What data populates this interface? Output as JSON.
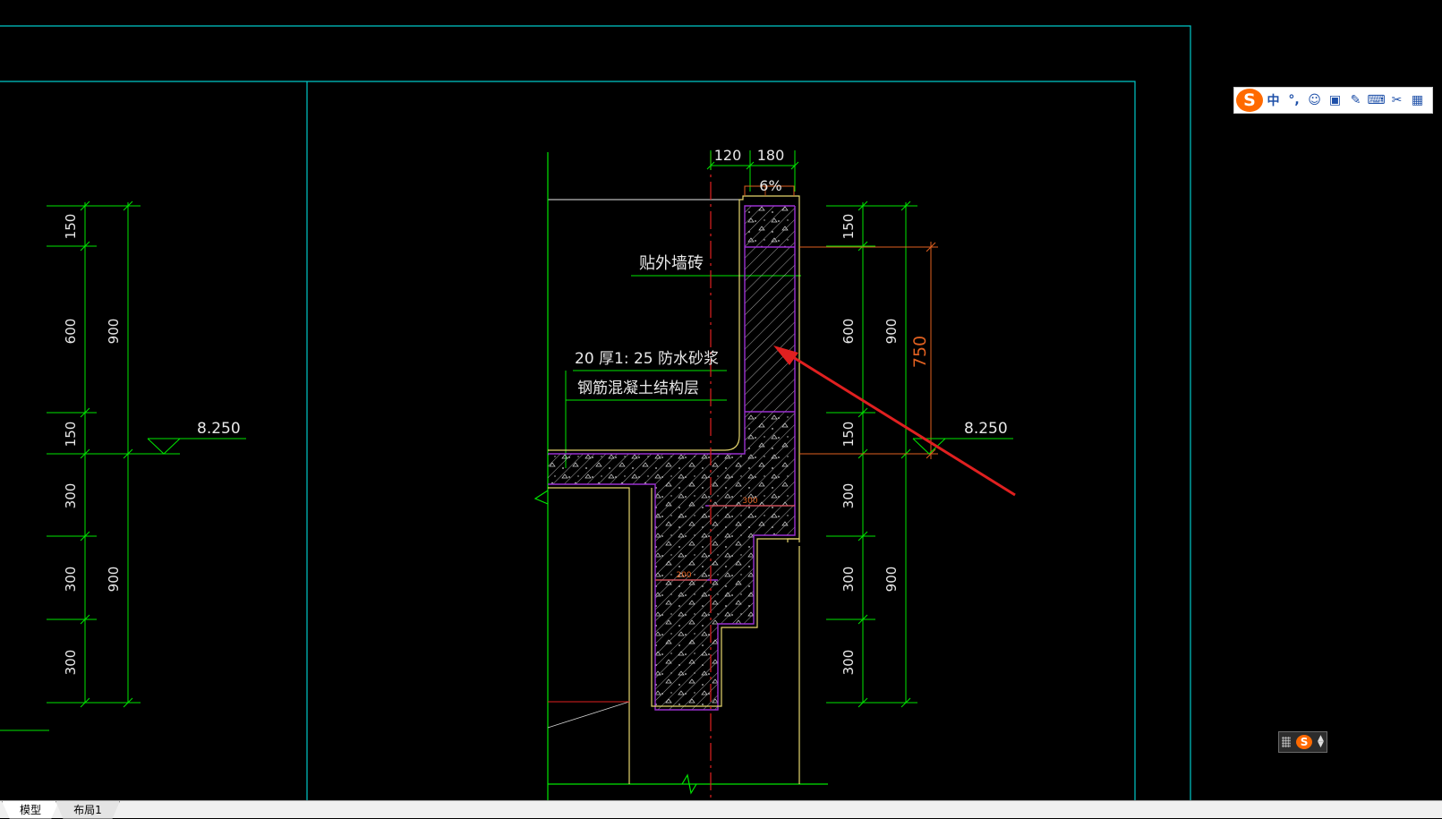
{
  "dims": {
    "top_w1": "120",
    "top_w2": "180",
    "slope": "6%",
    "left_seg": [
      "150",
      "600",
      "150",
      "300",
      "300",
      "300"
    ],
    "left_tot": [
      "900",
      "900"
    ],
    "right_seg": [
      "150",
      "600",
      "150",
      "300",
      "300",
      "300"
    ],
    "right_tot": [
      "900",
      "900"
    ],
    "red_dim": "750",
    "elev_left": "8.250",
    "elev_right": "8.250",
    "inner_300": "300",
    "inner_200": "200"
  },
  "labels": {
    "tile": "贴外墙砖",
    "mortar": "20 厚1: 25 防水砂浆",
    "concrete": "钢筋混凝土结构层"
  },
  "ime": {
    "logo": "S",
    "buttons": [
      "中",
      "°,",
      "☺",
      "▣",
      "✎",
      "⌨",
      "✂",
      "▦"
    ]
  },
  "tabs": {
    "model": "模型",
    "layout1": "布局1"
  },
  "colors": {
    "frame": "#00c8c8",
    "dim": "#00e600",
    "yellow": "#e6d66e",
    "purple": "#9b30d0",
    "red": "#e02020",
    "orange": "#e06020",
    "white": "#e8e8e8"
  }
}
